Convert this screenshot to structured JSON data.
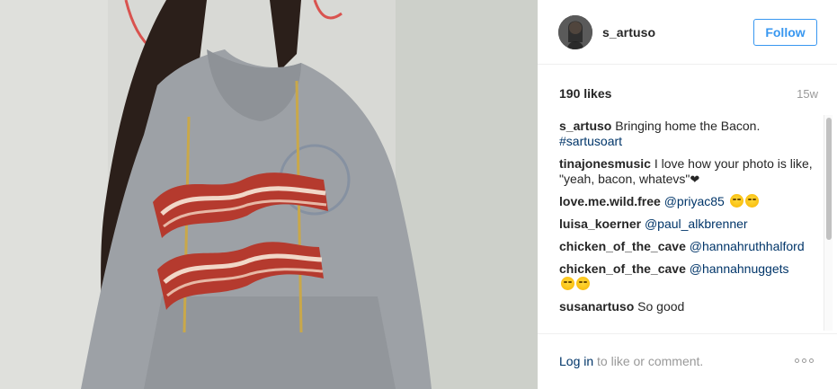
{
  "post": {
    "username": "s_artuso",
    "follow_label": "Follow",
    "likes": "190 likes",
    "age": "15w"
  },
  "comments": [
    {
      "user": "s_artuso",
      "text": "Bringing home the Bacon.",
      "link": "#sartusoart"
    },
    {
      "user": "tinajonesmusic",
      "text": "I love how your photo is like, \"yeah, bacon, whatevs\"",
      "suffix": "heart"
    },
    {
      "user": "love.me.wild.free",
      "link": "@priyac85",
      "suffix": "emoji2"
    },
    {
      "user": "luisa_koerner",
      "link": "@paul_alkbrenner"
    },
    {
      "user": "chicken_of_the_cave",
      "link": "@hannahruthhalford"
    },
    {
      "user": "chicken_of_the_cave",
      "link": "@hannahnuggets",
      "suffix": "emoji2"
    },
    {
      "user": "susanartuso",
      "text": "So good"
    }
  ],
  "footer": {
    "login_link": "Log in",
    "login_rest": " to like or comment.",
    "more_icon": "more-options-icon"
  },
  "colors": {
    "accent": "#3897f0",
    "link": "#003569",
    "muted": "#999999"
  }
}
